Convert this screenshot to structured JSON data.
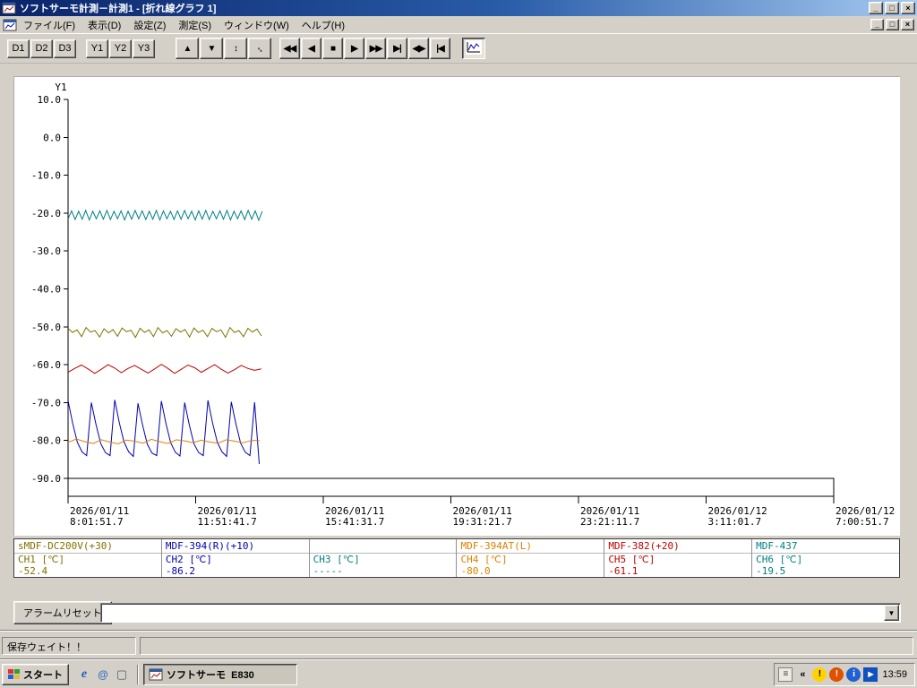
{
  "window": {
    "title": "ソフトサーモ計測－計測1 - [折れ線グラフ 1]",
    "controls": {
      "minimize": "_",
      "maximize": "□",
      "close": "×"
    }
  },
  "menu": {
    "items": [
      {
        "label": "ファイル(F)",
        "name": "menu-file"
      },
      {
        "label": "表示(D)",
        "name": "menu-view"
      },
      {
        "label": "設定(Z)",
        "name": "menu-settings"
      },
      {
        "label": "測定(S)",
        "name": "menu-measure"
      },
      {
        "label": "ウィンドウ(W)",
        "name": "menu-window"
      },
      {
        "label": "ヘルプ(H)",
        "name": "menu-help"
      }
    ]
  },
  "toolbar": {
    "select_buttons": [
      {
        "label": "D1",
        "name": "d1-button"
      },
      {
        "label": "D2",
        "name": "d2-button"
      },
      {
        "label": "D3",
        "name": "d3-button"
      }
    ],
    "axis_buttons": [
      {
        "label": "Y1",
        "name": "y1-button"
      },
      {
        "label": "Y2",
        "name": "y2-button"
      },
      {
        "label": "Y3",
        "name": "y3-button"
      }
    ],
    "nav_buttons": [
      {
        "glyph": "▲",
        "name": "scroll-up-button"
      },
      {
        "glyph": "▼",
        "name": "scroll-down-button"
      },
      {
        "glyph": "↕",
        "name": "expand-vertical-button"
      },
      {
        "glyph": "↔",
        "name": "zoom-fit-button",
        "rot": true
      }
    ],
    "transport_buttons": [
      {
        "glyph": "◀◀",
        "name": "fast-rewind-button"
      },
      {
        "glyph": "◀",
        "name": "back-button"
      },
      {
        "glyph": "■",
        "name": "stop-button"
      },
      {
        "glyph": "▶",
        "name": "forward-button"
      },
      {
        "glyph": "▶▶",
        "name": "fast-forward-button"
      },
      {
        "glyph": "▶|",
        "name": "jump-latest-button"
      },
      {
        "glyph": "◀▶",
        "name": "expand-horizontal-button"
      },
      {
        "glyph": "|◀",
        "name": "jump-start-button"
      }
    ]
  },
  "chart_data": {
    "type": "line",
    "title": "",
    "y_axis": {
      "label": "Y1",
      "ylim": [
        10,
        -90
      ],
      "ticks": [
        "10.0",
        "0.0",
        "-10.0",
        "-20.0",
        "-30.0",
        "-40.0",
        "-50.0",
        "-60.0",
        "-70.0",
        "-80.0",
        "-90.0"
      ]
    },
    "x_axis": {
      "total_hours": 22.983,
      "ticks": [
        {
          "date": "2026/01/11",
          "time": "8:01:51.7"
        },
        {
          "date": "2026/01/11",
          "time": "11:51:41.7"
        },
        {
          "date": "2026/01/11",
          "time": "15:41:31.7"
        },
        {
          "date": "2026/01/11",
          "time": "19:31:21.7"
        },
        {
          "date": "2026/01/11",
          "time": "23:21:11.7"
        },
        {
          "date": "2026/01/12",
          "time": "3:11:01.7"
        },
        {
          "date": "2026/01/12",
          "time": "7:00:51.7"
        }
      ]
    },
    "series": [
      {
        "name": "CH1",
        "label": "sMDF-DC200V(+30)",
        "unit": "℃",
        "color": "#807000",
        "t0": 0,
        "dt": 0.135,
        "values": [
          -50.4,
          -51.5,
          -50.8,
          -52.6,
          -50.2,
          -51.4,
          -51.0,
          -52.7,
          -50.5,
          -51.6,
          -50.7,
          -52.5,
          -50.3,
          -51.3,
          -50.9,
          -52.8,
          -50.4,
          -51.5,
          -50.8,
          -52.6,
          -50.2,
          -51.6,
          -51.0,
          -52.5,
          -50.5,
          -51.4,
          -50.7,
          -52.7,
          -50.3,
          -51.5,
          -50.9,
          -52.6,
          -50.4,
          -51.3,
          -50.8,
          -52.8,
          -50.2,
          -51.5,
          -51.0,
          -52.6,
          -50.4,
          -51.4,
          -50.6,
          -52.4
        ]
      },
      {
        "name": "CH2",
        "label": "MDF-394(R)(+10)",
        "unit": "℃",
        "color": "#0000b0",
        "t0": 0,
        "dt": 0.14,
        "values": [
          -69.5,
          -75.5,
          -80.5,
          -83,
          -84,
          -70,
          -75.8,
          -80.8,
          -83.2,
          -84,
          -69.3,
          -75.4,
          -80.4,
          -83,
          -84.2,
          -70.2,
          -76,
          -81,
          -83.3,
          -84,
          -69.6,
          -75.6,
          -80.6,
          -83.1,
          -84.1,
          -70,
          -75.9,
          -80.9,
          -83.2,
          -84,
          -69.4,
          -75.5,
          -80.5,
          -83,
          -84.2,
          -69.8,
          -75.7,
          -80.7,
          -83.1,
          -84,
          -69.9,
          -86.2
        ]
      },
      {
        "name": "CH3",
        "label": "",
        "unit": "℃",
        "color": "#008080",
        "t0": 0,
        "dt": 0,
        "values": []
      },
      {
        "name": "CH4",
        "label": "MDF-394AT(L)",
        "unit": "℃",
        "color": "#e08000",
        "t0": 0,
        "dt": 0.25,
        "values": [
          -80.5,
          -79.6,
          -80.3,
          -80.8,
          -79.8,
          -80.4,
          -80.9,
          -79.9,
          -80.2,
          -80.7,
          -79.7,
          -80.3,
          -80.8,
          -79.8,
          -80.1,
          -80.6,
          -79.9,
          -80.4,
          -80.7,
          -79.8,
          -80.2,
          -80.6,
          -80.0,
          -80.0
        ]
      },
      {
        "name": "CH5",
        "label": "MDF-382(+20)",
        "unit": "℃",
        "color": "#c00000",
        "t0": 0,
        "dt": 0.2,
        "values": [
          -62.0,
          -61.0,
          -60.1,
          -61.1,
          -62.3,
          -61.2,
          -60.0,
          -60.9,
          -62.1,
          -61.0,
          -60.2,
          -61.2,
          -62.2,
          -61.1,
          -59.9,
          -61.0,
          -62.3,
          -61.2,
          -60.1,
          -60.8,
          -62.0,
          -61.0,
          -60.0,
          -61.2,
          -62.2,
          -61.3,
          -60.2,
          -61.0,
          -61.5,
          -61.1
        ]
      },
      {
        "name": "CH6",
        "label": "MDF-437",
        "unit": "℃",
        "color": "#008080",
        "t0": 0,
        "dt": 0.106,
        "values": [
          -21.5,
          -19.4,
          -21.7,
          -19.5,
          -21.6,
          -19.3,
          -21.8,
          -19.5,
          -21.5,
          -19.4,
          -21.6,
          -19.3,
          -21.7,
          -19.5,
          -21.5,
          -19.4,
          -21.8,
          -19.5,
          -21.6,
          -19.3,
          -21.5,
          -19.4,
          -21.7,
          -19.5,
          -21.6,
          -19.3,
          -21.8,
          -19.4,
          -21.5,
          -19.5,
          -21.7,
          -19.4,
          -21.6,
          -19.3,
          -21.5,
          -19.5,
          -21.8,
          -19.4,
          -21.6,
          -19.3,
          -21.7,
          -19.5,
          -21.5,
          -19.4,
          -21.6,
          -19.3,
          -21.8,
          -19.5,
          -21.5,
          -19.4,
          -21.7,
          -19.3,
          -21.6,
          -19.4,
          -21.9,
          -19.5
        ]
      }
    ]
  },
  "channels": [
    {
      "name": "sMDF-DC200V(+30)",
      "channel": "CH1 [℃]",
      "value": "-52.4",
      "color": "#807000"
    },
    {
      "name": "MDF-394(R)(+10)",
      "channel": "CH2 [℃]",
      "value": "-86.2",
      "color": "#0000b0"
    },
    {
      "name": "",
      "channel": "CH3 [℃]",
      "value": "-----",
      "color": "#008080"
    },
    {
      "name": "MDF-394AT(L)",
      "channel": "CH4 [℃]",
      "value": "-80.0",
      "color": "#e08000"
    },
    {
      "name": "MDF-382(+20)",
      "channel": "CH5 [℃]",
      "value": "-61.1",
      "color": "#c00000"
    },
    {
      "name": "MDF-437",
      "channel": "CH6 [℃]",
      "value": "-19.5",
      "color": "#008080"
    }
  ],
  "alarm": {
    "reset_label": "アラームリセット",
    "combo_value": ""
  },
  "status": {
    "text": "保存ウェイト！！"
  },
  "taskbar": {
    "start_label": "スタート",
    "quick_launch": [
      {
        "name": "ie-icon",
        "glyph": "e"
      },
      {
        "name": "mail-icon",
        "glyph": "@"
      },
      {
        "name": "show-desktop-icon",
        "glyph": "▢"
      }
    ],
    "task_label": "ソフトサーモ  E830",
    "tray_icons": [
      {
        "name": "keyboard-icon",
        "glyph": "≡"
      },
      {
        "name": "tray-expand-chevron",
        "glyph": "«"
      },
      {
        "name": "security-warning-icon",
        "glyph": "!"
      },
      {
        "name": "alert-icon",
        "glyph": "!"
      },
      {
        "name": "info-icon",
        "glyph": "i"
      },
      {
        "name": "media-play-icon",
        "glyph": "▶"
      }
    ],
    "clock": "13:59"
  },
  "ui_icons": {
    "dropdown": "▼"
  }
}
